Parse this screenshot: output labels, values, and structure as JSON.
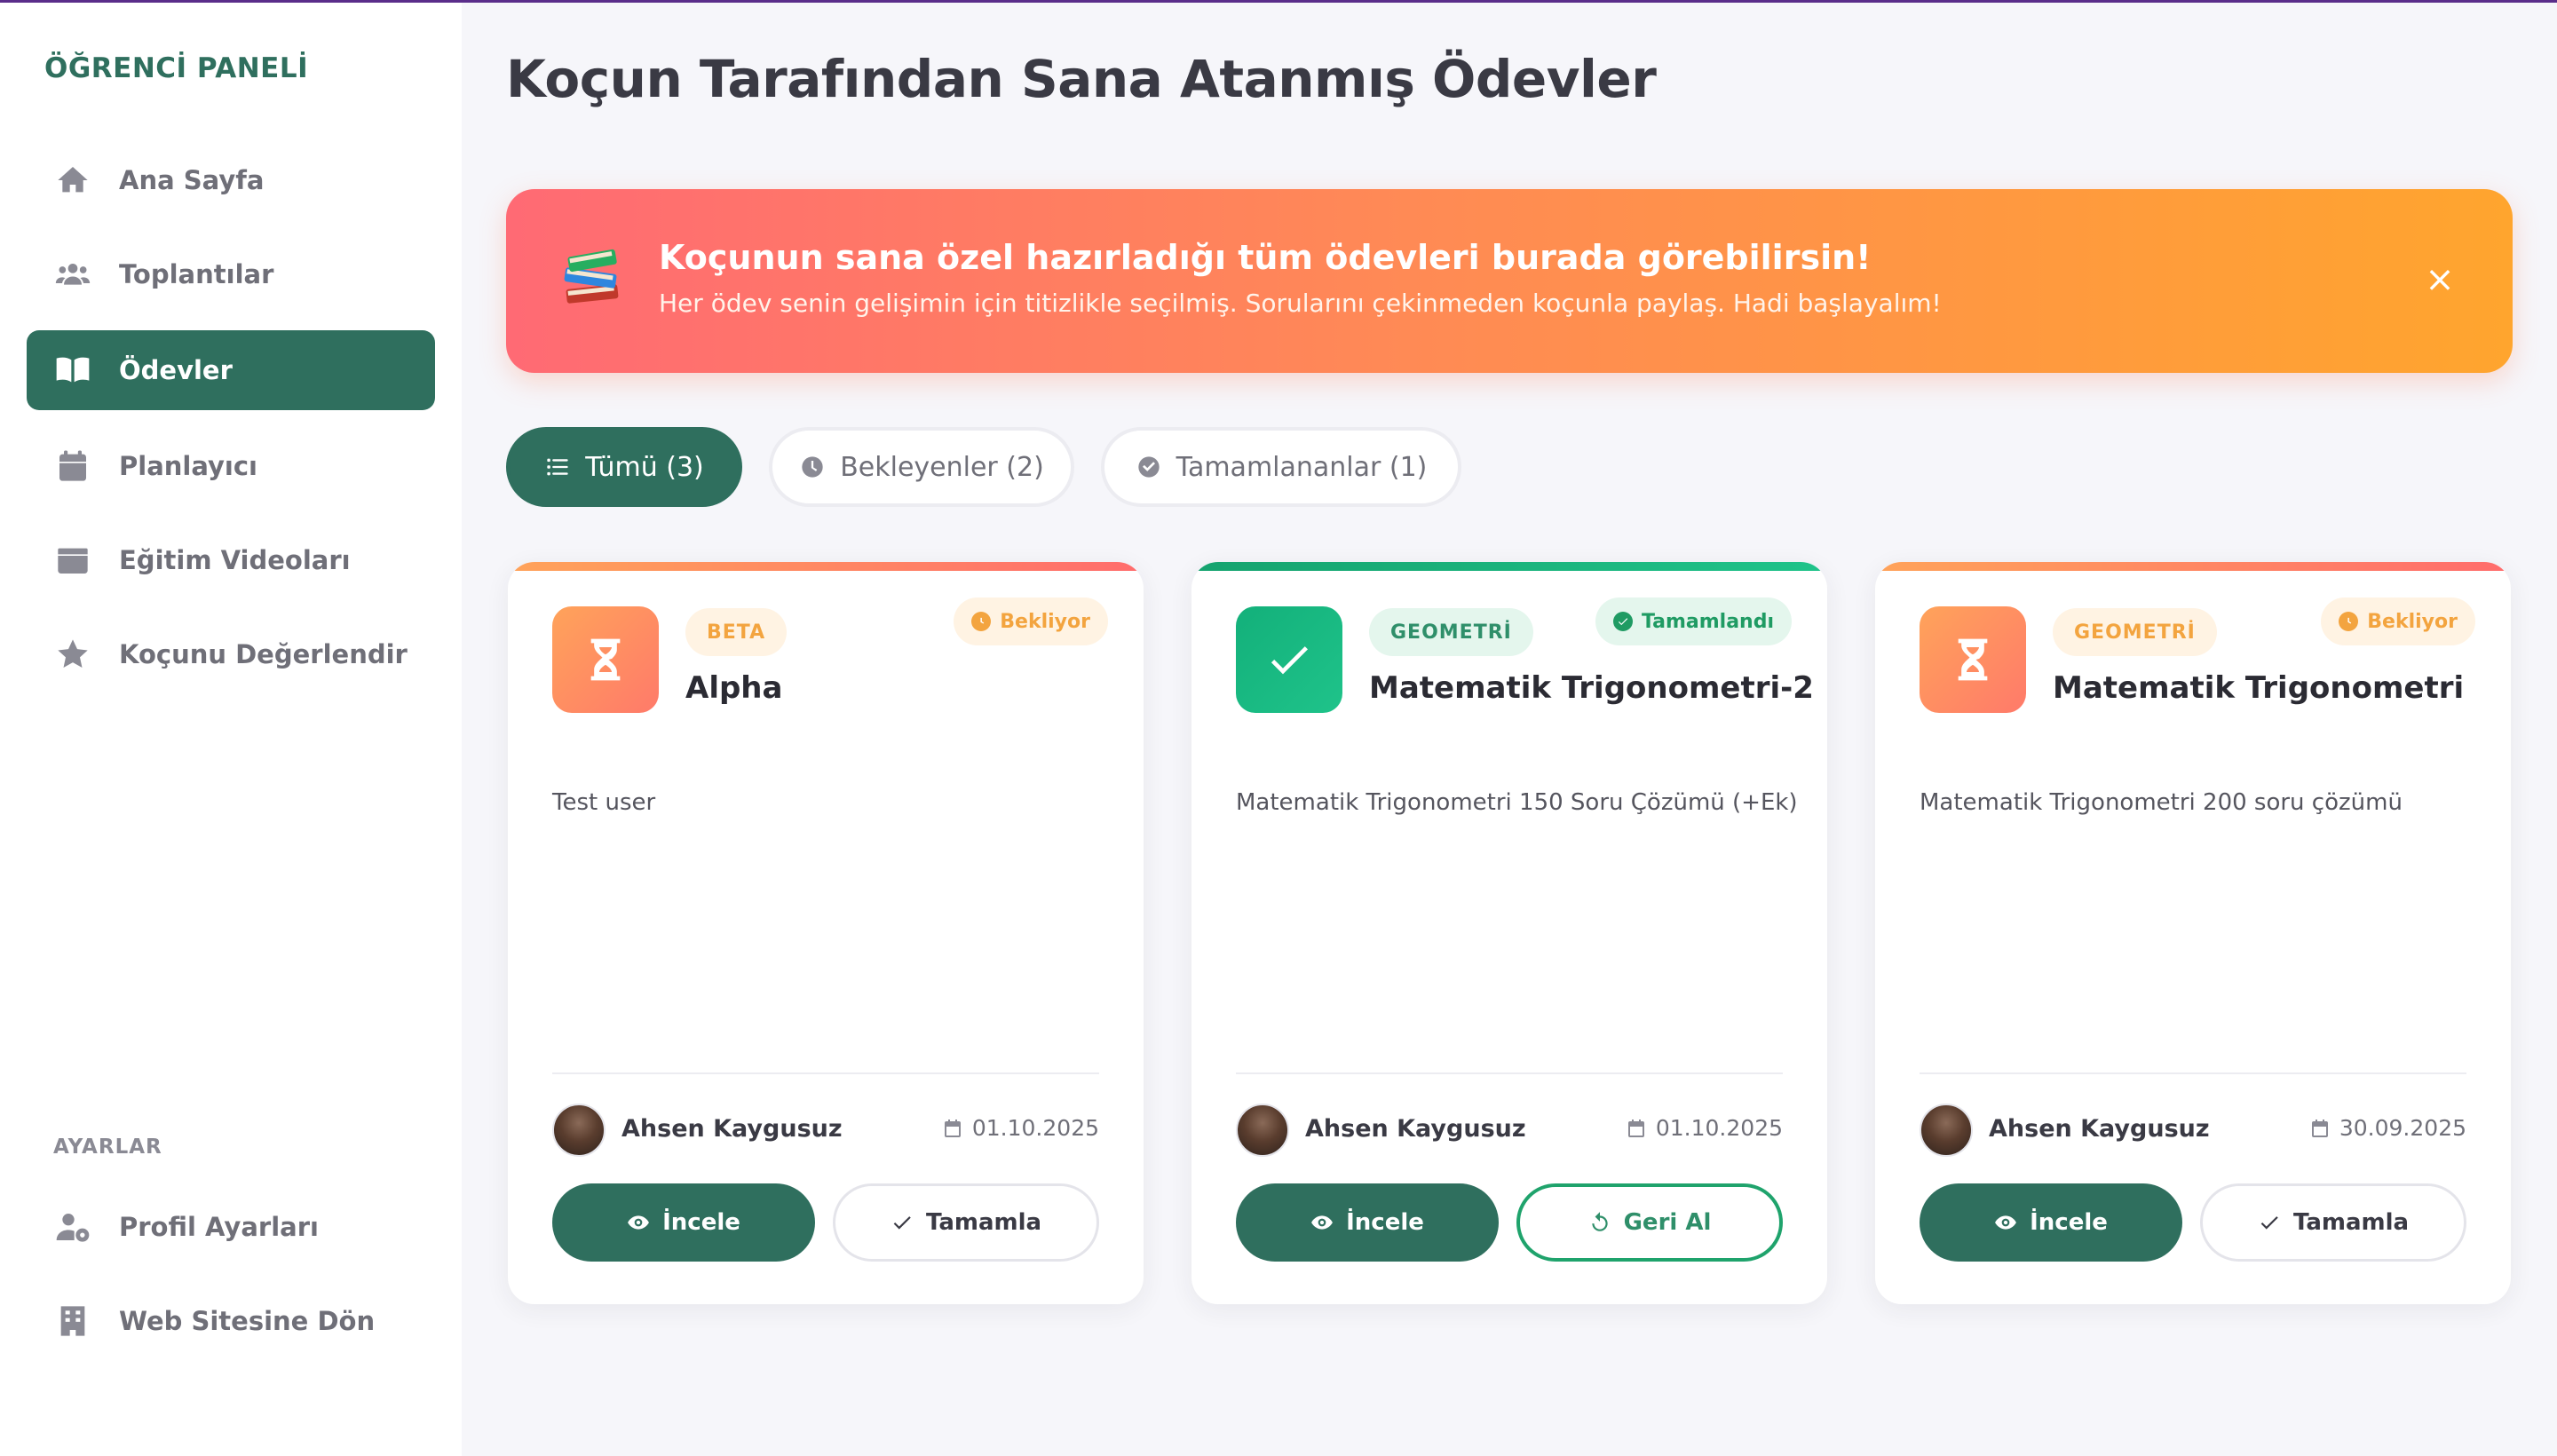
{
  "sidebar": {
    "brand": "ÖĞRENCİ PANELİ",
    "items": [
      {
        "label": "Ana Sayfa",
        "icon": "home-icon"
      },
      {
        "label": "Toplantılar",
        "icon": "users-icon"
      },
      {
        "label": "Ödevler",
        "icon": "book-icon",
        "active": true
      },
      {
        "label": "Planlayıcı",
        "icon": "calendar-icon"
      },
      {
        "label": "Eğitim Videoları",
        "icon": "video-box-icon"
      },
      {
        "label": "Koçunu Değerlendir",
        "icon": "star-icon"
      }
    ],
    "settings_label": "AYARLAR",
    "settings_items": [
      {
        "label": "Profil Ayarları",
        "icon": "user-gear-icon"
      },
      {
        "label": "Web Sitesine Dön",
        "icon": "building-icon"
      }
    ]
  },
  "page": {
    "title": "Koçun Tarafından Sana Atanmış Ödevler"
  },
  "banner": {
    "emoji": "books-emoji",
    "title": "Koçunun sana özel hazırladığı tüm ödevleri burada görebilirsin!",
    "subtitle": "Her ödev senin gelişimin için titizlikle seçilmiş. Sorularını çekinmeden koçunla paylaş. Hadi başlayalım!",
    "close": "×"
  },
  "filters": [
    {
      "label": "Tümü (3)",
      "icon": "list-icon",
      "active": true
    },
    {
      "label": "Bekleyenler (2)",
      "icon": "clock-icon"
    },
    {
      "label": "Tamamlananlar (1)",
      "icon": "check-circle-icon"
    }
  ],
  "cards": [
    {
      "subject": "BETA",
      "status": "Bekliyor",
      "state": "pending",
      "title": "Alpha",
      "description": "Test user",
      "teacher": "Ahsen Kaygusuz",
      "date": "01.10.2025",
      "primary_label": "İncele",
      "secondary_label": "Tamamla"
    },
    {
      "subject": "GEOMETRİ",
      "status": "Tamamlandı",
      "state": "done",
      "title": "Matematik Trigonometri-2",
      "description": "Matematik Trigonometri 150 Soru Çözümü (+Ek)",
      "teacher": "Ahsen Kaygusuz",
      "date": "01.10.2025",
      "primary_label": "İncele",
      "secondary_label": "Geri Al"
    },
    {
      "subject": "GEOMETRİ",
      "status": "Bekliyor",
      "state": "pending",
      "title": "Matematik Trigonometri",
      "description": "Matematik Trigonometri 200 soru çözümü",
      "teacher": "Ahsen Kaygusuz",
      "date": "30.09.2025",
      "primary_label": "İncele",
      "secondary_label": "Tamamla"
    }
  ],
  "colors": {
    "primary": "#2f6f5e",
    "pending": "#f3a43f",
    "done": "#1f9b63",
    "banner_start": "#ff6a74",
    "banner_end": "#ffa52e"
  }
}
